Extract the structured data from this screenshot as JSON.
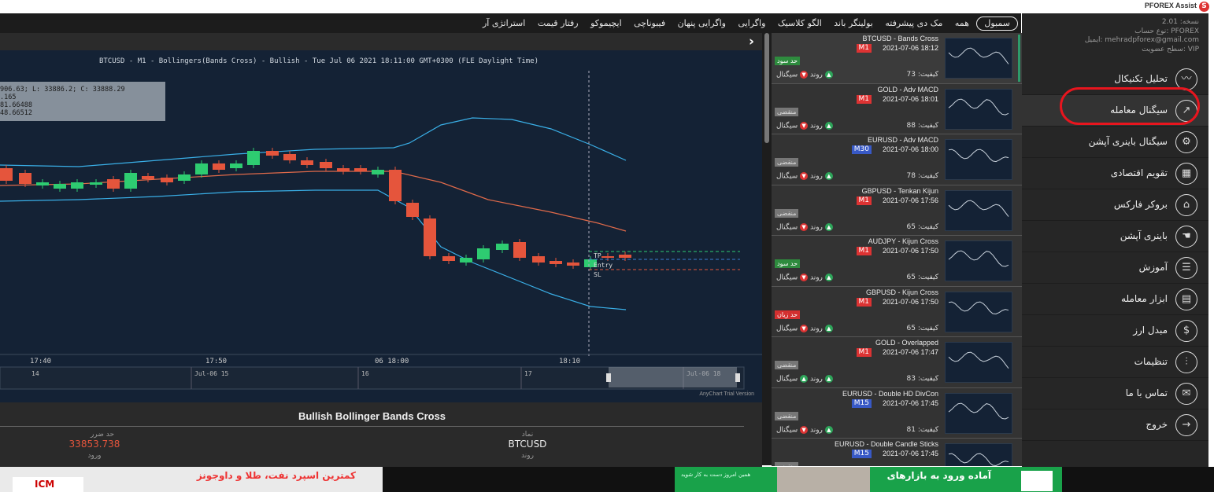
{
  "app": {
    "title": "PFOREX Assist",
    "logo_letter": "S"
  },
  "topmenu": [
    "سمبول",
    "همه",
    "مک دی پیشرفته",
    "بولینگر باند",
    "الگو کلاسیک",
    "واگرایی",
    "واگرایی پنهان",
    "فیبوناچی",
    "ایچیموکو",
    "رفتار قیمت",
    "استراتژی آر"
  ],
  "chart": {
    "title": "BTCUSD - M1 - Bollingers(Bands Cross) - Bullish - Tue Jul 06 2021 18:11:00 GMT+0300 (FLE Daylight Time)",
    "tooltip": [
      "906.63; L: 33886.2; C: 33888.29",
      ".165",
      "81.66488",
      "48.66512"
    ],
    "time_labels": [
      "17:40",
      "17:50",
      "06 18:00",
      "18:10"
    ],
    "nav_labels": [
      "14",
      "Jul-06 15",
      "16",
      "17",
      "Jul-06 18"
    ],
    "levels": [
      "TP",
      "Entry",
      "SL"
    ],
    "watermark": "AnyChart Trial Version"
  },
  "signals": [
    {
      "name": "BTCUSD - Bands Cross",
      "tf": "M1",
      "time": "2021-07-06 18:12",
      "badge": "حد سود",
      "badge_type": "tp",
      "quality": "کیفیت: 73",
      "trend": "روند",
      "signal": "سیگنال",
      "trend_dir": "down",
      "signal_dir": "up"
    },
    {
      "name": "GOLD - Adv MACD",
      "tf": "M1",
      "time": "2021-07-06 18:01",
      "badge": "منقضی",
      "badge_type": "ex",
      "quality": "کیفیت: 88",
      "trend": "روند",
      "signal": "سیگنال",
      "trend_dir": "down",
      "signal_dir": "up"
    },
    {
      "name": "EURUSD - Adv MACD",
      "tf": "M30",
      "time": "2021-07-06 18:00",
      "badge": "منقضی",
      "badge_type": "ex",
      "quality": "کیفیت: 78",
      "trend": "روند",
      "signal": "سیگنال",
      "trend_dir": "down",
      "signal_dir": "up"
    },
    {
      "name": "GBPUSD - Tenkan Kijun",
      "tf": "M1",
      "time": "2021-07-06 17:56",
      "badge": "منقضی",
      "badge_type": "ex",
      "quality": "کیفیت: 65",
      "trend": "روند",
      "signal": "سیگنال",
      "trend_dir": "down",
      "signal_dir": "up"
    },
    {
      "name": "AUDJPY - Kijun Cross",
      "tf": "M1",
      "time": "2021-07-06 17:50",
      "badge": "حد سود",
      "badge_type": "tp",
      "quality": "کیفیت: 65",
      "trend": "روند",
      "signal": "سیگنال",
      "trend_dir": "down",
      "signal_dir": "up"
    },
    {
      "name": "GBPUSD - Kijun Cross",
      "tf": "M1",
      "time": "2021-07-06 17:50",
      "badge": "حد زیان",
      "badge_type": "sl",
      "quality": "کیفیت: 65",
      "trend": "روند",
      "signal": "سیگنال",
      "trend_dir": "down",
      "signal_dir": "up"
    },
    {
      "name": "GOLD - Overlapped",
      "tf": "M1",
      "time": "2021-07-06 17:47",
      "badge": "منقضی",
      "badge_type": "ex",
      "quality": "کیفیت: 83",
      "trend": "روند",
      "signal": "سیگنال",
      "trend_dir": "up",
      "signal_dir": "up"
    },
    {
      "name": "EURUSD - Double HD DivCon",
      "tf": "M15",
      "time": "2021-07-06 17:45",
      "badge": "منقضی",
      "badge_type": "ex",
      "quality": "کیفیت: 81",
      "trend": "روند",
      "signal": "سیگنال",
      "trend_dir": "down",
      "signal_dir": "up"
    },
    {
      "name": "EURUSD - Double Candle Sticks",
      "tf": "M15",
      "time": "2021-07-06 17:45",
      "badge": "منقضی",
      "badge_type": "ex",
      "quality": "",
      "trend": "",
      "signal": "",
      "trend_dir": "",
      "signal_dir": ""
    }
  ],
  "sidebar": {
    "info": [
      "نسخه: 2.01",
      "نوع حساب: PFOREX",
      "ایمیل: mehradpforex@gmail.com",
      "سطح عضویت: VIP"
    ],
    "items": [
      {
        "label": "تحلیل تکنیکال",
        "icon": "chart-line-icon",
        "glyph": "〰"
      },
      {
        "label": "سیگنال معامله",
        "icon": "signal-trend-icon",
        "glyph": "↗"
      },
      {
        "label": "سیگنال باینری آپشن",
        "icon": "gear-icon",
        "glyph": "⚙"
      },
      {
        "label": "تقویم اقتصادی",
        "icon": "calendar-icon",
        "glyph": "▦"
      },
      {
        "label": "بروکر فارکس",
        "icon": "factory-icon",
        "glyph": "⌂"
      },
      {
        "label": "باینری آپشن",
        "icon": "hand-icon",
        "glyph": "☚"
      },
      {
        "label": "آموزش",
        "icon": "book-icon",
        "glyph": "☰"
      },
      {
        "label": "ابزار معامله",
        "icon": "calculator-icon",
        "glyph": "▤"
      },
      {
        "label": "مبدل ارز",
        "icon": "coins-icon",
        "glyph": "$"
      },
      {
        "label": "تنظیمات",
        "icon": "sliders-icon",
        "glyph": "⫶"
      },
      {
        "label": "تماس با ما",
        "icon": "envelope-icon",
        "glyph": "✉"
      },
      {
        "label": "خروج",
        "icon": "exit-arrow-icon",
        "glyph": "→"
      }
    ]
  },
  "details": {
    "title": "Bullish Bollinger Bands Cross",
    "sl_label": "حد ضرر",
    "sl_value": "33853.738",
    "entry_label": "ورود",
    "symbol_label": "نماد",
    "symbol_value": "BTCUSD",
    "trend_label": "روند"
  },
  "ads": {
    "icm": "ICM",
    "icm_text": "کمترین اسپرد نفت، طلا و داوجونز",
    "right_text": "آماده ورود به بازارهای",
    "small_text": "همین امروز دست به کار شوید"
  },
  "colors": {
    "bull": "#2ecc71",
    "bear": "#e5553c",
    "band": "#3ab0e8",
    "mid": "#e06a4a",
    "red_circle": "#e8151e"
  }
}
